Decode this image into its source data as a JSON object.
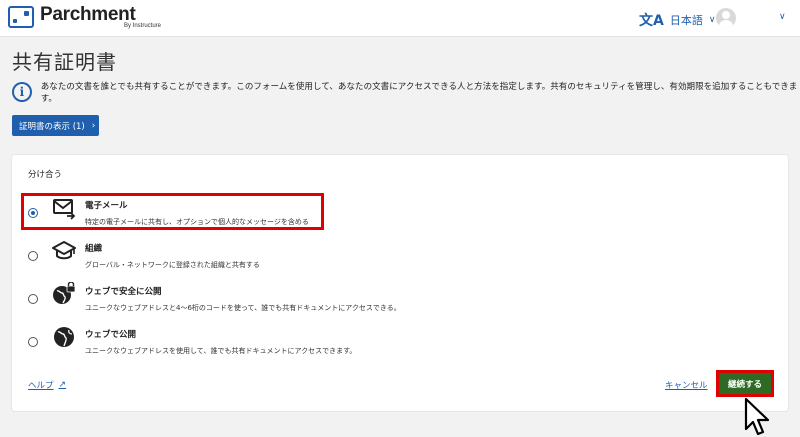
{
  "header": {
    "brand": "Parchment",
    "brand_sub": "By Instructure",
    "language": "日本語",
    "language_icon": "translate-icon",
    "avatar_icon": "user-avatar-icon"
  },
  "page": {
    "title": "共有証明書",
    "info_text": "あなたの文書を誰とでも共有することができます。このフォームを使用して、あなたの文書にアクセスできる人と方法を指定します。共有のセキュリティを管理し、有効期限を追加することもできます。",
    "view_certificates_label": "証明書の表示 (1)"
  },
  "share": {
    "section_title": "分け合う",
    "options": [
      {
        "name": "電子メール",
        "desc": "特定の電子メールに共有し、オプションで個人的なメッセージを含める",
        "selected": true,
        "icon": "email-send-icon"
      },
      {
        "name": "組織",
        "desc": "グローバル・ネットワークに登録された組織と共有する",
        "selected": false,
        "icon": "graduation-cap-icon"
      },
      {
        "name": "ウェブで安全に公開",
        "desc": "ユニークなウェブアドレスと4〜6桁のコードを使って、誰でも共有ドキュメントにアクセスできる。",
        "selected": false,
        "icon": "globe-lock-icon"
      },
      {
        "name": "ウェブで公開",
        "desc": "ユニークなウェブアドレスを使用して、誰でも共有ドキュメントにアクセスできます。",
        "selected": false,
        "icon": "globe-icon"
      }
    ]
  },
  "footer": {
    "help_label": "ヘルプ",
    "cancel_label": "キャンセル",
    "continue_label": "継続する"
  },
  "colors": {
    "brand_blue": "#1f5fad",
    "continue_green": "#2e6a23",
    "highlight_red": "#e00000"
  }
}
